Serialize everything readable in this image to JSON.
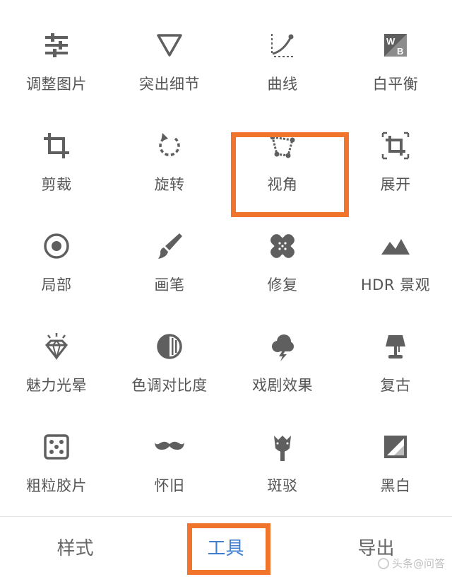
{
  "tools": [
    {
      "label": "调整图片",
      "icon": "sliders-icon"
    },
    {
      "label": "突出细节",
      "icon": "triangle-details-icon"
    },
    {
      "label": "曲线",
      "icon": "curves-icon"
    },
    {
      "label": "白平衡",
      "icon": "white-balance-icon"
    },
    {
      "label": "剪裁",
      "icon": "crop-icon"
    },
    {
      "label": "旋转",
      "icon": "rotate-icon"
    },
    {
      "label": "视角",
      "icon": "perspective-icon"
    },
    {
      "label": "展开",
      "icon": "expand-icon"
    },
    {
      "label": "局部",
      "icon": "selective-target-icon"
    },
    {
      "label": "画笔",
      "icon": "brush-icon"
    },
    {
      "label": "修复",
      "icon": "healing-bandage-icon"
    },
    {
      "label": "HDR 景观",
      "icon": "mountains-icon"
    },
    {
      "label": "魅力光晕",
      "icon": "glamour-diamond-icon"
    },
    {
      "label": "色调对比度",
      "icon": "tonal-contrast-icon"
    },
    {
      "label": "戏剧效果",
      "icon": "storm-cloud-icon"
    },
    {
      "label": "复古",
      "icon": "lamp-icon"
    },
    {
      "label": "粗粒胶片",
      "icon": "dice-grain-icon"
    },
    {
      "label": "怀旧",
      "icon": "mustache-icon"
    },
    {
      "label": "斑驳",
      "icon": "guitar-grunge-icon"
    },
    {
      "label": "黑白",
      "icon": "black-white-icon"
    }
  ],
  "bottom_tabs": {
    "styles": "样式",
    "tools": "工具",
    "export": "导出"
  },
  "watermark": "头条@问答",
  "colors": {
    "highlight": "#f0742c",
    "active_tab": "#3f7fd0",
    "icon": "#5f5f5f"
  }
}
